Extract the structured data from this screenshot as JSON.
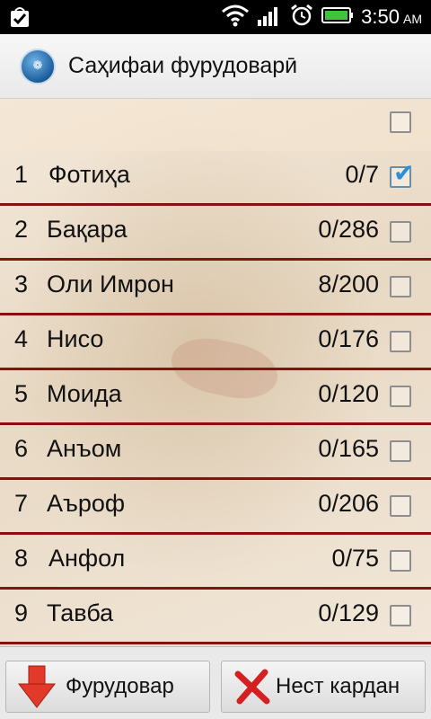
{
  "app": {
    "title": "Саҳифаи фурудоварӣ",
    "logo_icon": "quran-logo-icon"
  },
  "status_bar": {
    "time": "3:50",
    "ampm": "AM",
    "icons": [
      "notification-check-icon",
      "wifi-icon",
      "signal-icon",
      "alarm-icon",
      "battery-icon"
    ]
  },
  "select_all": {
    "checked": false
  },
  "surahs": [
    {
      "num": "1",
      "name": "Фотиҳа",
      "progress": "0/7",
      "checked": true
    },
    {
      "num": "2",
      "name": "Бақара",
      "progress": "0/286",
      "checked": false
    },
    {
      "num": "3",
      "name": "Оли Имрон",
      "progress": "8/200",
      "checked": false
    },
    {
      "num": "4",
      "name": "Нисо",
      "progress": "0/176",
      "checked": false
    },
    {
      "num": "5",
      "name": "Моида",
      "progress": "0/120",
      "checked": false
    },
    {
      "num": "6",
      "name": "Анъом",
      "progress": "0/165",
      "checked": false
    },
    {
      "num": "7",
      "name": "Аъроф",
      "progress": "0/206",
      "checked": false
    },
    {
      "num": "8",
      "name": "Анфол",
      "progress": "0/75",
      "checked": false
    },
    {
      "num": "9",
      "name": "Тавба",
      "progress": "0/129",
      "checked": false
    }
  ],
  "buttons": {
    "download_label": "Фурудовар",
    "delete_label": "Нест кардан"
  },
  "colors": {
    "row_divider": "#8a0f0f",
    "check_accent": "#2e8fd6",
    "download_arrow": "#e23a2a",
    "delete_x": "#d42020"
  }
}
